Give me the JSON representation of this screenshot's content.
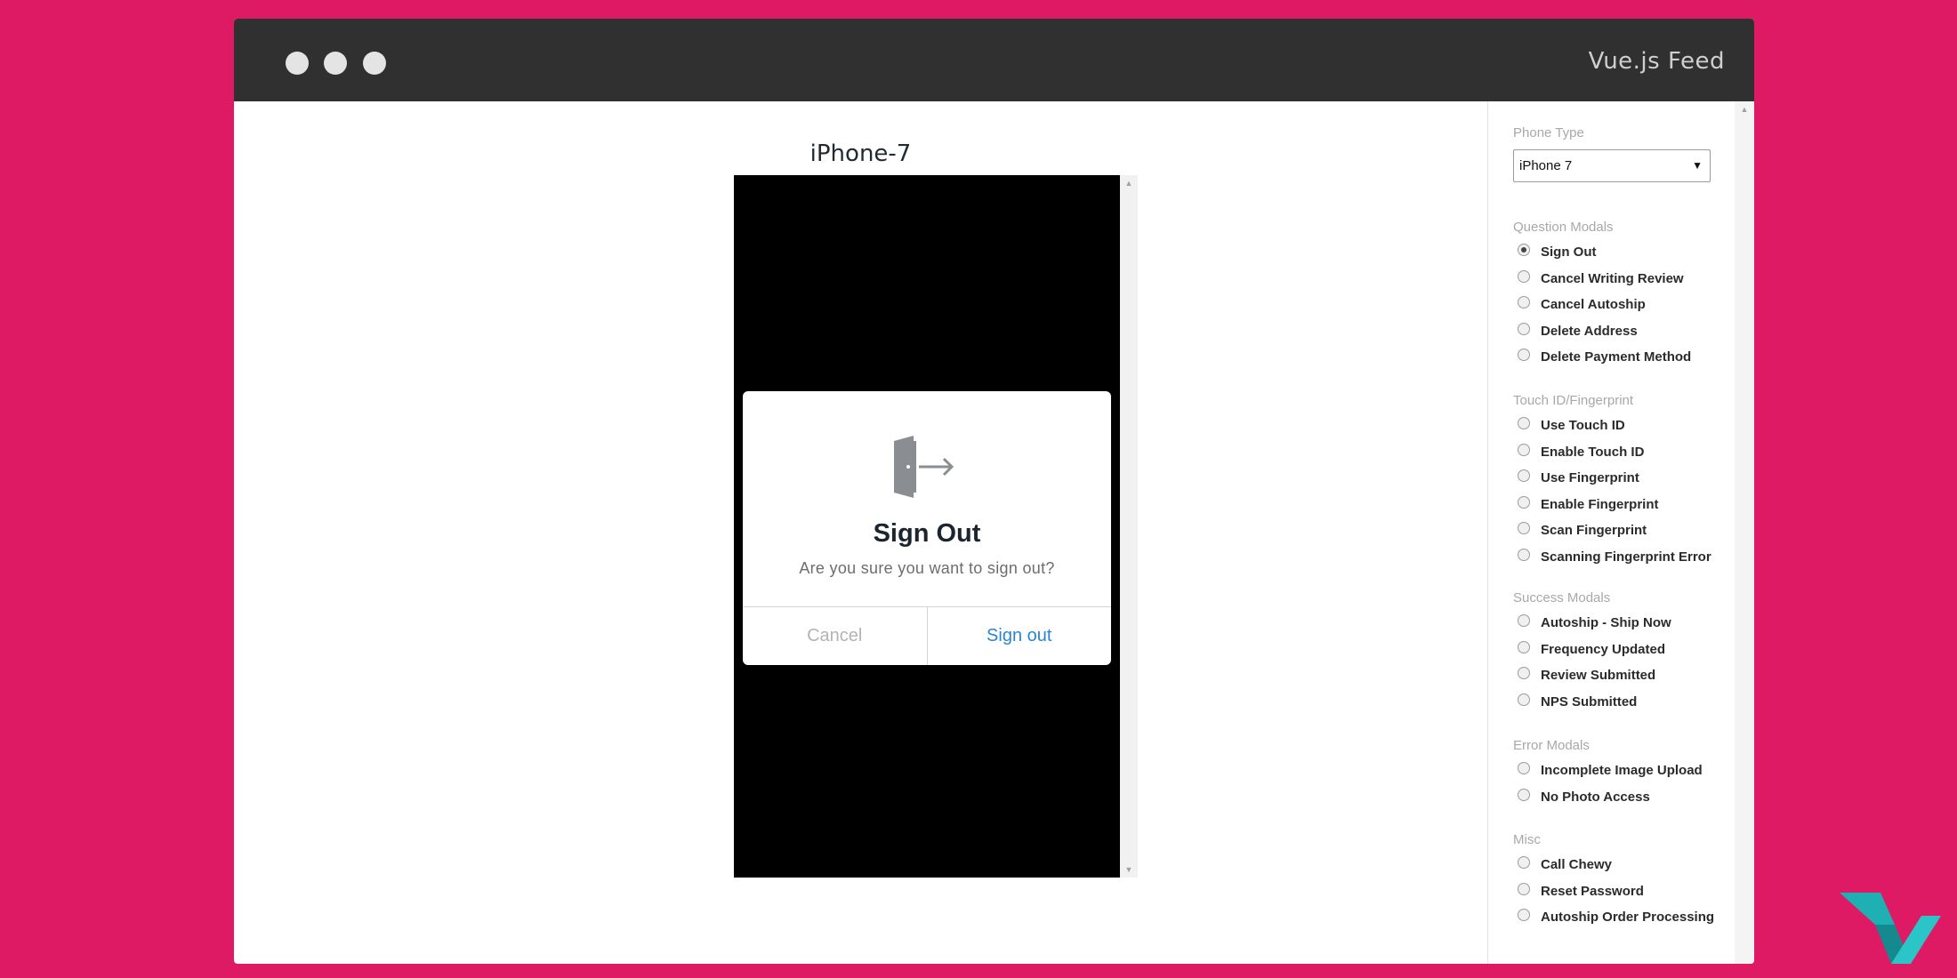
{
  "window": {
    "title": "Vue.js Feed"
  },
  "preview": {
    "device_title": "iPhone-7",
    "modal": {
      "icon": "sign-out-door-icon",
      "title": "Sign Out",
      "message": "Are you sure you want to sign out?",
      "cancel_label": "Cancel",
      "confirm_label": "Sign out"
    }
  },
  "sidebar": {
    "phone_type": {
      "label": "Phone Type",
      "selected": "iPhone 7"
    },
    "groups": [
      {
        "label": "Question Modals",
        "items": [
          "Sign Out",
          "Cancel Writing Review",
          "Cancel Autoship",
          "Delete Address",
          "Delete Payment Method"
        ]
      },
      {
        "label": "Touch ID/Fingerprint",
        "items": [
          "Use Touch ID",
          "Enable Touch ID",
          "Use Fingerprint",
          "Enable Fingerprint",
          "Scan Fingerprint",
          "Scanning Fingerprint Error"
        ]
      },
      {
        "label": "Success Modals",
        "items": [
          "Autoship - Ship Now",
          "Frequency Updated",
          "Review Submitted",
          "NPS Submitted"
        ]
      },
      {
        "label": "Error Modals",
        "items": [
          "Incomplete Image Upload",
          "No Photo Access"
        ]
      },
      {
        "label": "Misc",
        "items": [
          "Call Chewy",
          "Reset Password",
          "Autoship Order Processing"
        ]
      }
    ],
    "selected_option": "Sign Out"
  },
  "colors": {
    "background": "#de1a65",
    "titlebar": "#303030",
    "link_blue": "#2a86d1"
  }
}
